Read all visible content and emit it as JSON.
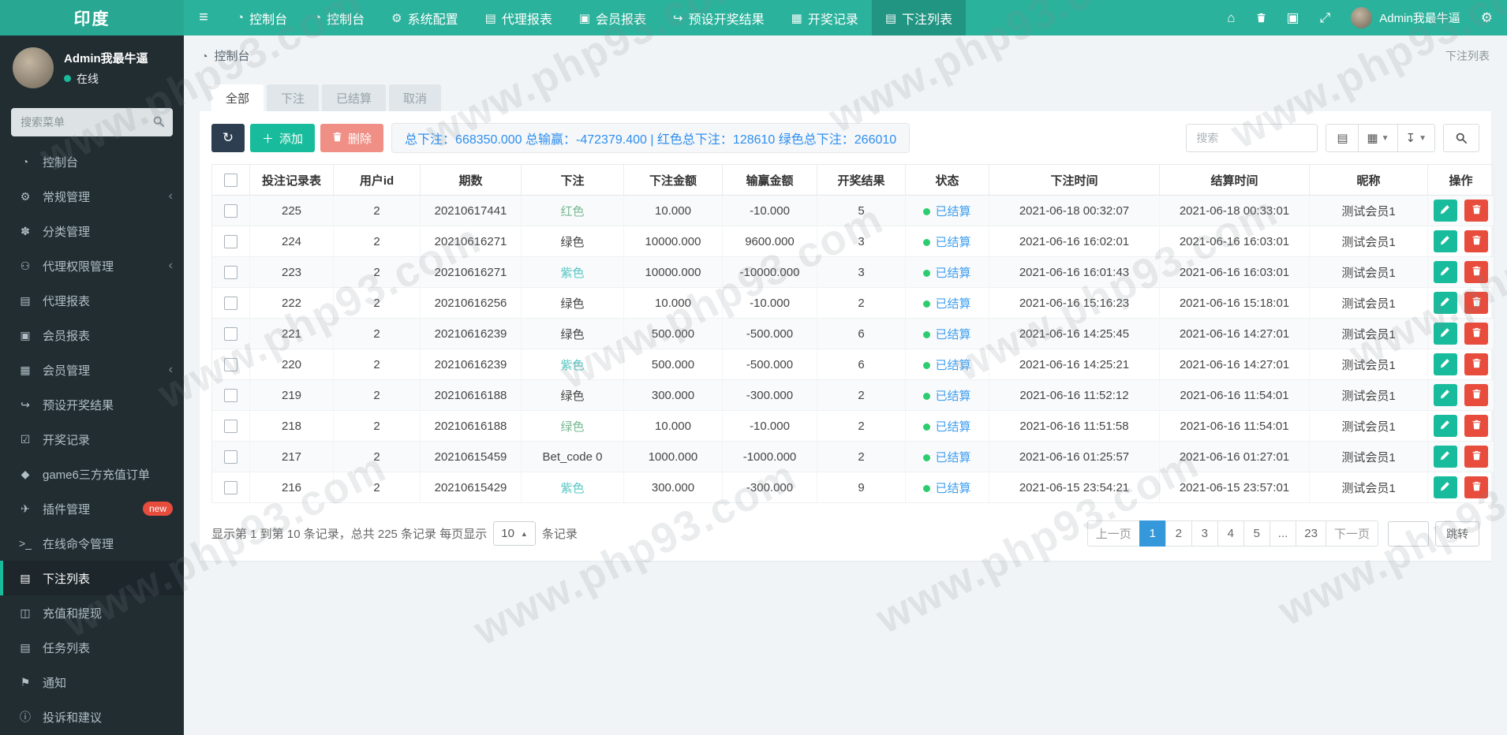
{
  "brand": "印度",
  "watermark": "www.php93.com",
  "colors": {
    "topbar": "#2bb29c",
    "accent": "#18bc9c",
    "danger": "#e74c3c",
    "primary_dark": "#2c3e50",
    "summary_link": "#2d8ff0",
    "page_active": "#3498db",
    "status_dot": "#2ecc71"
  },
  "navbar": {
    "items": [
      {
        "label": "控制台",
        "icon": "dashboard-icon",
        "active": false
      },
      {
        "label": "控制台",
        "icon": "dashboard-icon",
        "active": false
      },
      {
        "label": "系统配置",
        "icon": "gear-icon",
        "active": false
      },
      {
        "label": "代理报表",
        "icon": "report-icon",
        "active": false
      },
      {
        "label": "会员报表",
        "icon": "member-report-icon",
        "active": false
      },
      {
        "label": "预设开奖结果",
        "icon": "preset-icon",
        "active": false
      },
      {
        "label": "开奖记录",
        "icon": "calendar-icon",
        "active": false
      },
      {
        "label": "下注列表",
        "icon": "list-icon",
        "active": true
      }
    ],
    "user_name": "Admin我最牛逼"
  },
  "sidebar": {
    "user_name": "Admin我最牛逼",
    "user_status": "在线",
    "search_placeholder": "搜索菜单",
    "items": [
      {
        "label": "控制台",
        "icon": "dashboard-icon"
      },
      {
        "label": "常规管理",
        "icon": "gears-icon",
        "chevron": true
      },
      {
        "label": "分类管理",
        "icon": "leaf-icon"
      },
      {
        "label": "代理权限管理",
        "icon": "users-icon",
        "chevron": true
      },
      {
        "label": "代理报表",
        "icon": "book-icon"
      },
      {
        "label": "会员报表",
        "icon": "contact-book-icon"
      },
      {
        "label": "会员管理",
        "icon": "member-list-icon",
        "chevron": true
      },
      {
        "label": "预设开奖结果",
        "icon": "share-icon"
      },
      {
        "label": "开奖记录",
        "icon": "calendar-check-icon"
      },
      {
        "label": "game6三方充值订单",
        "icon": "gem-icon"
      },
      {
        "label": "插件管理",
        "icon": "rocket-icon",
        "badge": "new"
      },
      {
        "label": "在线命令管理",
        "icon": "terminal-icon"
      },
      {
        "label": "下注列表",
        "icon": "bet-list-icon",
        "active": true
      },
      {
        "label": "充值和提现",
        "icon": "money-icon"
      },
      {
        "label": "任务列表",
        "icon": "task-list-icon"
      },
      {
        "label": "通知",
        "icon": "bullhorn-icon"
      },
      {
        "label": "投诉和建议",
        "icon": "info-icon"
      }
    ]
  },
  "breadcrumb": {
    "label": "控制台"
  },
  "corner_title": "下注列表",
  "tabs": [
    {
      "label": "全部",
      "active": true
    },
    {
      "label": "下注",
      "active": false
    },
    {
      "label": "已结算",
      "active": false
    },
    {
      "label": "取消",
      "active": false
    }
  ],
  "toolbar": {
    "add_label": "添加",
    "delete_label": "删除",
    "summary": "总下注：668350.000 总输赢：-472379.400 | 红色总下注：128610 绿色总下注：266010",
    "search_placeholder": "搜索"
  },
  "table": {
    "columns": [
      "投注记录表",
      "用户id",
      "期数",
      "下注",
      "下注金额",
      "输赢金额",
      "开奖结果",
      "状态",
      "下注时间",
      "结算时间",
      "昵称",
      "操作"
    ],
    "status_label": "已结算",
    "rows": [
      {
        "id": "225",
        "user_id": "2",
        "period": "20210617441",
        "bet": "红色",
        "bet_color": "green",
        "amount": "10.000",
        "win": "-10.000",
        "result": "5",
        "bet_time": "2021-06-18 00:32:07",
        "settle_time": "2021-06-18 00:33:01",
        "nickname": "测试会员1"
      },
      {
        "id": "224",
        "user_id": "2",
        "period": "20210616271",
        "bet": "绿色",
        "bet_color": "dark",
        "amount": "10000.000",
        "win": "9600.000",
        "result": "3",
        "bet_time": "2021-06-16 16:02:01",
        "settle_time": "2021-06-16 16:03:01",
        "nickname": "测试会员1"
      },
      {
        "id": "223",
        "user_id": "2",
        "period": "20210616271",
        "bet": "紫色",
        "bet_color": "teal",
        "amount": "10000.000",
        "win": "-10000.000",
        "result": "3",
        "bet_time": "2021-06-16 16:01:43",
        "settle_time": "2021-06-16 16:03:01",
        "nickname": "测试会员1"
      },
      {
        "id": "222",
        "user_id": "2",
        "period": "20210616256",
        "bet": "绿色",
        "bet_color": "dark",
        "amount": "10.000",
        "win": "-10.000",
        "result": "2",
        "bet_time": "2021-06-16 15:16:23",
        "settle_time": "2021-06-16 15:18:01",
        "nickname": "测试会员1"
      },
      {
        "id": "221",
        "user_id": "2",
        "period": "20210616239",
        "bet": "绿色",
        "bet_color": "dark",
        "amount": "500.000",
        "win": "-500.000",
        "result": "6",
        "bet_time": "2021-06-16 14:25:45",
        "settle_time": "2021-06-16 14:27:01",
        "nickname": "测试会员1"
      },
      {
        "id": "220",
        "user_id": "2",
        "period": "20210616239",
        "bet": "紫色",
        "bet_color": "teal",
        "amount": "500.000",
        "win": "-500.000",
        "result": "6",
        "bet_time": "2021-06-16 14:25:21",
        "settle_time": "2021-06-16 14:27:01",
        "nickname": "测试会员1"
      },
      {
        "id": "219",
        "user_id": "2",
        "period": "20210616188",
        "bet": "绿色",
        "bet_color": "dark",
        "amount": "300.000",
        "win": "-300.000",
        "result": "2",
        "bet_time": "2021-06-16 11:52:12",
        "settle_time": "2021-06-16 11:54:01",
        "nickname": "测试会员1"
      },
      {
        "id": "218",
        "user_id": "2",
        "period": "20210616188",
        "bet": "绿色",
        "bet_color": "green",
        "amount": "10.000",
        "win": "-10.000",
        "result": "2",
        "bet_time": "2021-06-16 11:51:58",
        "settle_time": "2021-06-16 11:54:01",
        "nickname": "测试会员1"
      },
      {
        "id": "217",
        "user_id": "2",
        "period": "20210615459",
        "bet": "Bet_code 0",
        "bet_color": "dark",
        "amount": "1000.000",
        "win": "-1000.000",
        "result": "2",
        "bet_time": "2021-06-16 01:25:57",
        "settle_time": "2021-06-16 01:27:01",
        "nickname": "测试会员1"
      },
      {
        "id": "216",
        "user_id": "2",
        "period": "20210615429",
        "bet": "紫色",
        "bet_color": "teal",
        "amount": "300.000",
        "win": "-300.000",
        "result": "9",
        "bet_time": "2021-06-15 23:54:21",
        "settle_time": "2021-06-15 23:57:01",
        "nickname": "测试会员1"
      }
    ]
  },
  "pagination": {
    "info_prefix": "显示第 1 到第 10 条记录，总共 225 条记录 每页显示",
    "per_page": "10",
    "info_suffix": "条记录",
    "prev": "上一页",
    "next": "下一页",
    "pages": [
      "1",
      "2",
      "3",
      "4",
      "5",
      "...",
      "23"
    ],
    "active_page": "1",
    "jump_label": "跳转"
  }
}
